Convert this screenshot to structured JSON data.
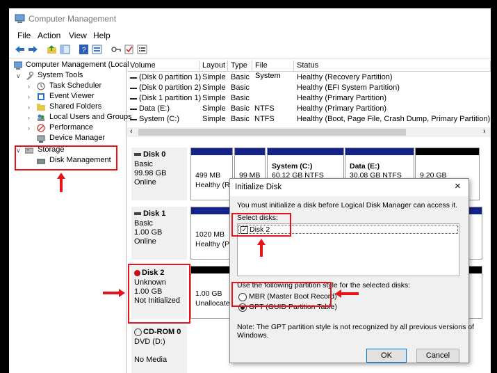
{
  "window": {
    "title": "Computer Management"
  },
  "menu": [
    "File",
    "Action",
    "View",
    "Help"
  ],
  "toolbar_icons": [
    "back-icon",
    "forward-icon",
    "up-folder-icon",
    "show-hide-tree-icon",
    "help-icon",
    "properties-icon",
    "key-icon",
    "check-icon",
    "list-icon"
  ],
  "tree": {
    "root": "Computer Management (Local",
    "items": [
      {
        "label": "System Tools",
        "indent": 1
      },
      {
        "label": "Task Scheduler",
        "indent": 2
      },
      {
        "label": "Event Viewer",
        "indent": 2
      },
      {
        "label": "Shared Folders",
        "indent": 2
      },
      {
        "label": "Local Users and Groups",
        "indent": 2
      },
      {
        "label": "Performance",
        "indent": 2
      },
      {
        "label": "Device Manager",
        "indent": 2
      },
      {
        "label": "Storage",
        "indent": 1
      },
      {
        "label": "Disk Management",
        "indent": 2
      }
    ]
  },
  "volumes": {
    "columns": [
      "Volume",
      "Layout",
      "Type",
      "File System",
      "Status"
    ],
    "rows": [
      [
        "(Disk 0 partition 1)",
        "Simple",
        "Basic",
        "",
        "Healthy (Recovery Partition)"
      ],
      [
        "(Disk 0 partition 2)",
        "Simple",
        "Basic",
        "",
        "Healthy (EFI System Partition)"
      ],
      [
        "(Disk 1 partition 1)",
        "Simple",
        "Basic",
        "",
        "Healthy (Primary Partition)"
      ],
      [
        "Data (E:)",
        "Simple",
        "Basic",
        "NTFS",
        "Healthy (Primary Partition)"
      ],
      [
        "System (C:)",
        "Simple",
        "Basic",
        "NTFS",
        "Healthy (Boot, Page File, Crash Dump, Primary Partition)"
      ]
    ]
  },
  "disks": [
    {
      "name": "Disk 0",
      "type": "Basic",
      "size": "99.98 GB",
      "state": "Online"
    },
    {
      "name": "Disk 1",
      "type": "Basic",
      "size": "1.00 GB",
      "state": "Online"
    },
    {
      "name": "Disk 2",
      "type": "Unknown",
      "size": "1.00 GB",
      "state": "Not Initialized"
    },
    {
      "name": "CD-ROM 0",
      "type": "DVD (D:)",
      "size": "",
      "state": "No Media"
    }
  ],
  "partitions": {
    "d0p1": {
      "size": "499 MB",
      "status": "Healthy (Re"
    },
    "d0p2": {
      "size": "99 MB"
    },
    "d0p3": {
      "name": "System  (C:)",
      "size": "60.12 GB NTFS"
    },
    "d0p4": {
      "name": "Data  (E:)",
      "size": "30.08 GB NTFS"
    },
    "d0p5": {
      "size": "9.20 GB"
    },
    "d1p1": {
      "size": "1020 MB",
      "status": "Healthy (Pr"
    },
    "d2p1": {
      "size": "1.00 GB",
      "status": "Unallocate"
    }
  },
  "dialog": {
    "title": "Initialize Disk",
    "message": "You must initialize a disk before Logical Disk Manager can access it.",
    "select_label": "Select disks:",
    "disk_item": "Disk 2",
    "style_label": "Use the following partition style for the selected disks:",
    "mbr": "MBR (Master Boot Record)",
    "gpt": "GPT (GUID Partition Table)",
    "note": "Note: The GPT partition style is not recognized by all previous versions of",
    "note2": "Windows.",
    "ok": "OK",
    "cancel": "Cancel"
  },
  "colors": {
    "highlight": "#e8121b",
    "partition_bar": "#14238a",
    "unallocated_bar": "#000000"
  }
}
